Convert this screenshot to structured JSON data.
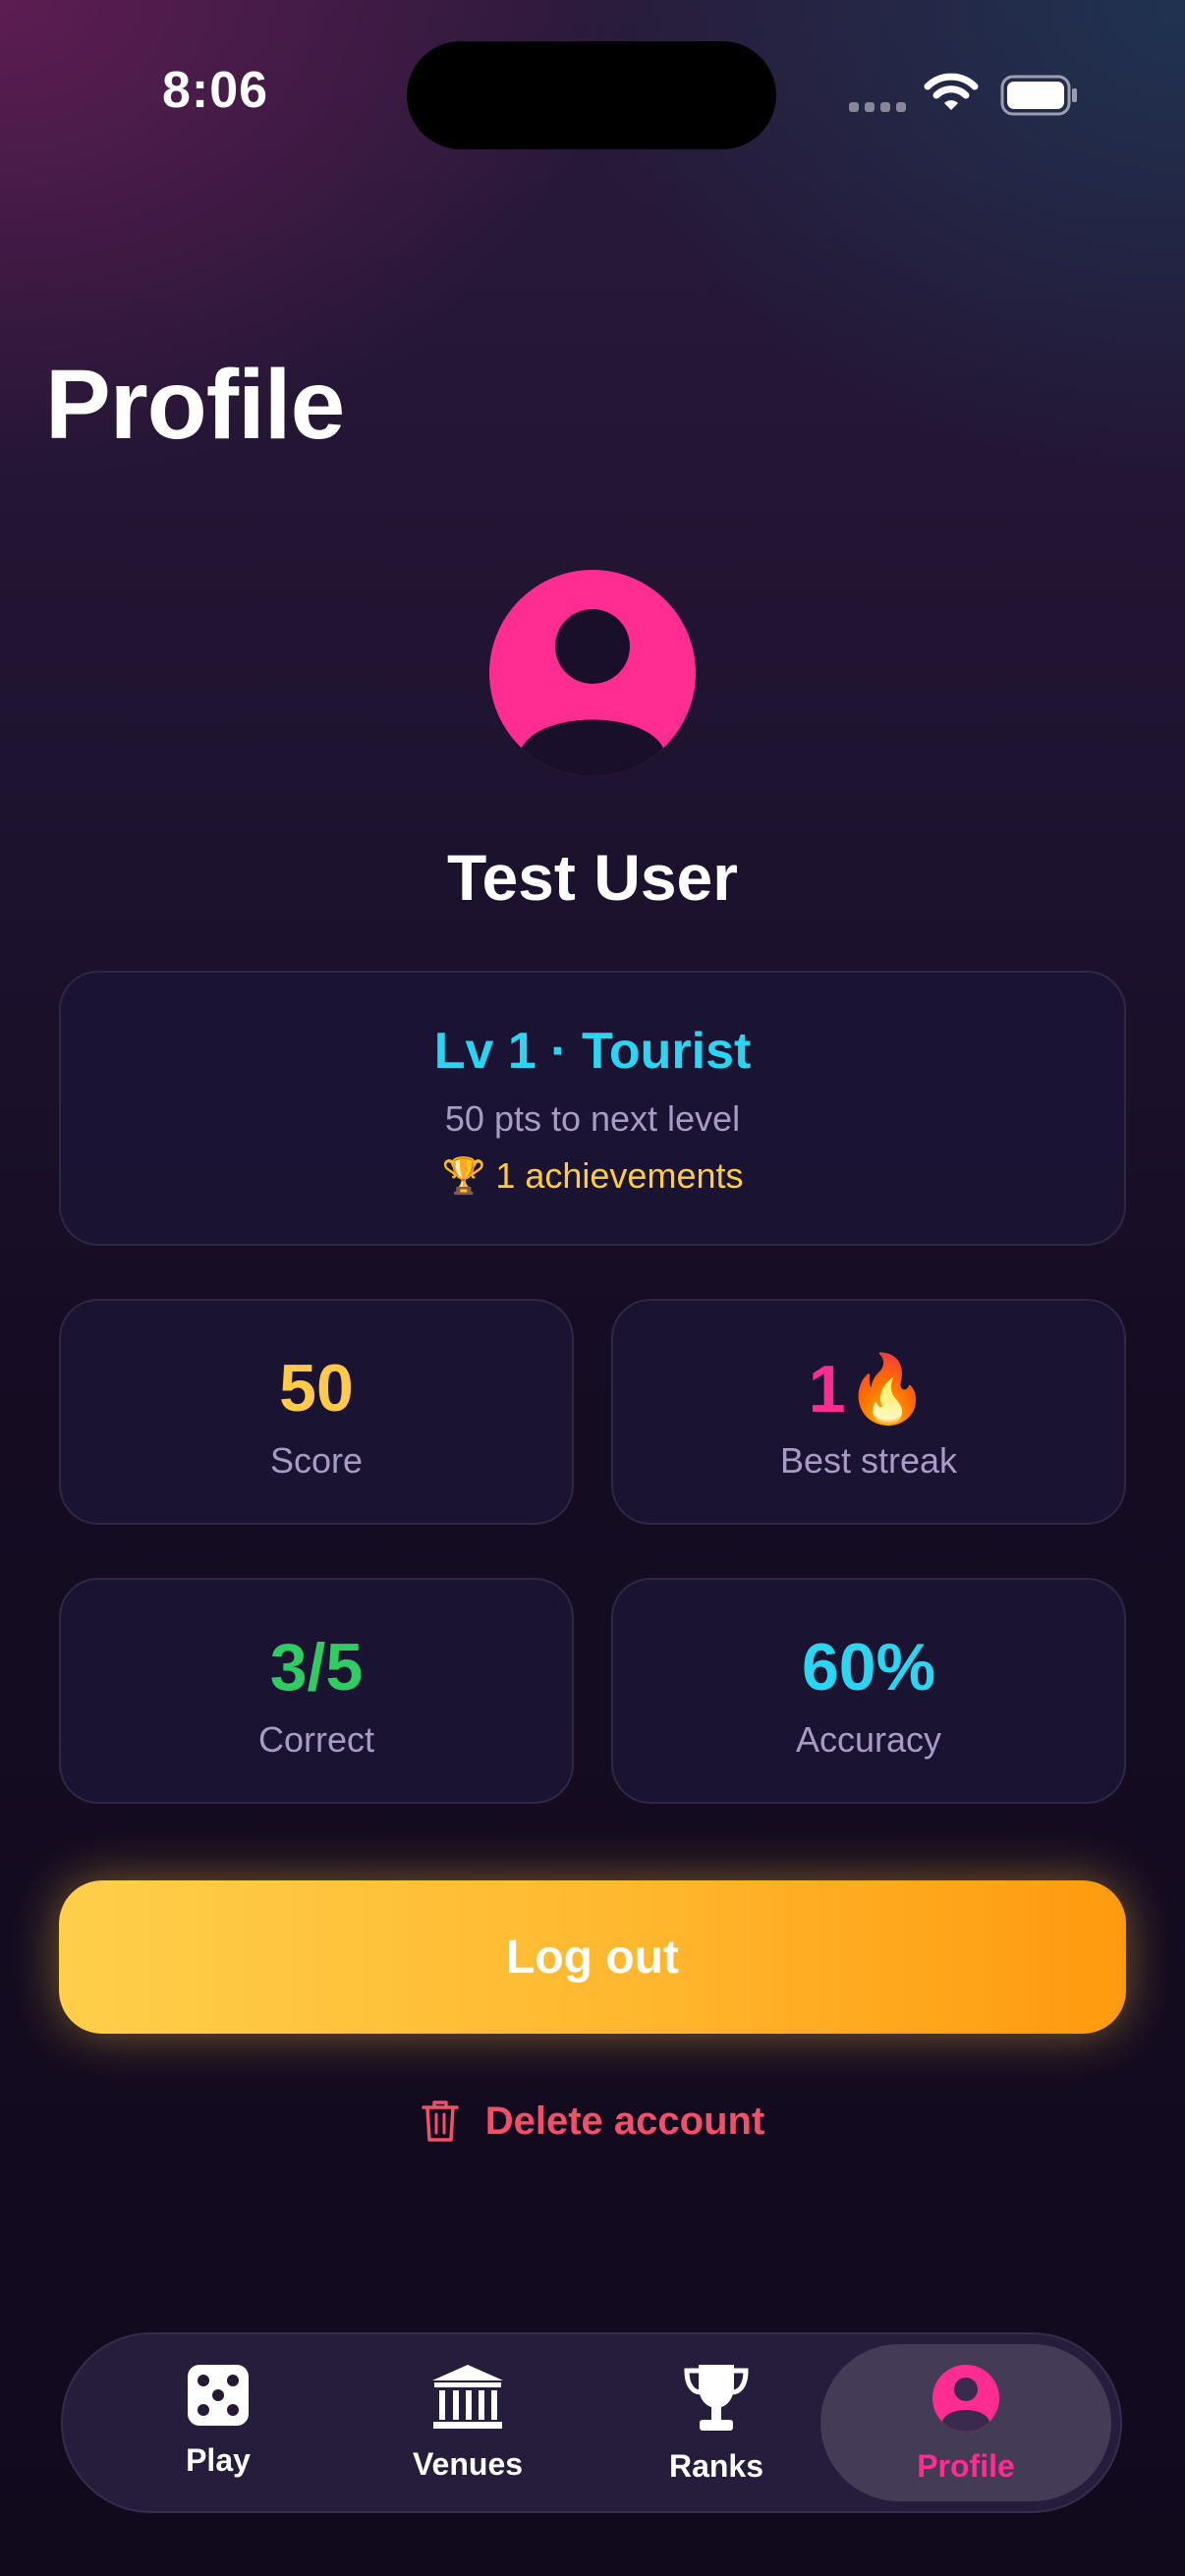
{
  "status_bar": {
    "time": "8:06"
  },
  "page": {
    "title": "Profile"
  },
  "profile": {
    "name": "Test User",
    "level_title": "Lv 1 · Tourist",
    "next_level": "50 pts to next level",
    "achievements": "🏆 1 achievements"
  },
  "stats": [
    {
      "value": "50",
      "label": "Score",
      "color": "#ffc94a"
    },
    {
      "value": "1🔥",
      "label": "Best streak",
      "color": "#ff2d92"
    },
    {
      "value": "3/5",
      "label": "Correct",
      "color": "#2ecc62"
    },
    {
      "value": "60%",
      "label": "Accuracy",
      "color": "#2ad5f2"
    }
  ],
  "actions": {
    "logout": "Log out",
    "delete": "Delete account"
  },
  "tabs": [
    {
      "label": "Play",
      "icon": "dice-icon"
    },
    {
      "label": "Venues",
      "icon": "building-columns-icon"
    },
    {
      "label": "Ranks",
      "icon": "trophy-icon"
    },
    {
      "label": "Profile",
      "icon": "person-circle-icon",
      "active": true
    }
  ],
  "colors": {
    "accent_pink": "#ff2d92",
    "accent_yellow": "#ffc94a",
    "danger": "#f0506a"
  }
}
